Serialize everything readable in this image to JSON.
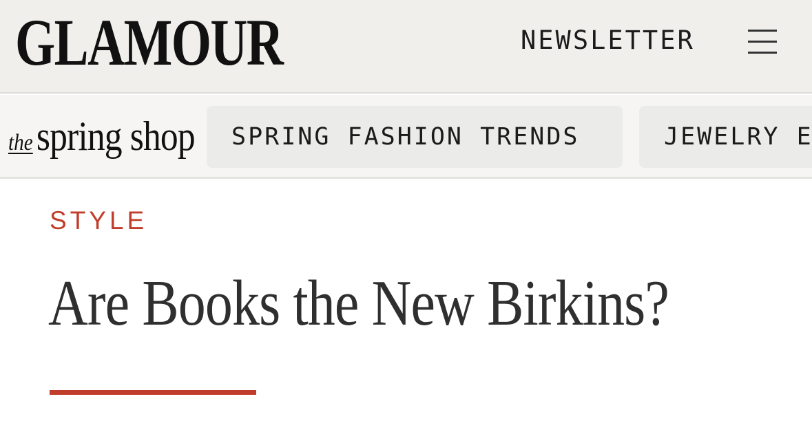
{
  "header": {
    "logo_text": "GLAMOUR",
    "newsletter_label": "NEWSLETTER",
    "menu_icon": "hamburger-menu-icon"
  },
  "shop_nav": {
    "logo_prefix": "the",
    "logo_main": "spring shop",
    "items": [
      {
        "label": "SPRING FASHION TRENDS"
      },
      {
        "label": "JEWELRY E"
      }
    ]
  },
  "article": {
    "category": "STYLE",
    "title": "Are Books the New Birkins?"
  },
  "colors": {
    "accent": "#c13d2b",
    "header_bg": "#f0efec",
    "nav_bg": "#f6f5f3",
    "pill_bg": "#ebebe9",
    "headline_text": "#2f2f2f"
  }
}
